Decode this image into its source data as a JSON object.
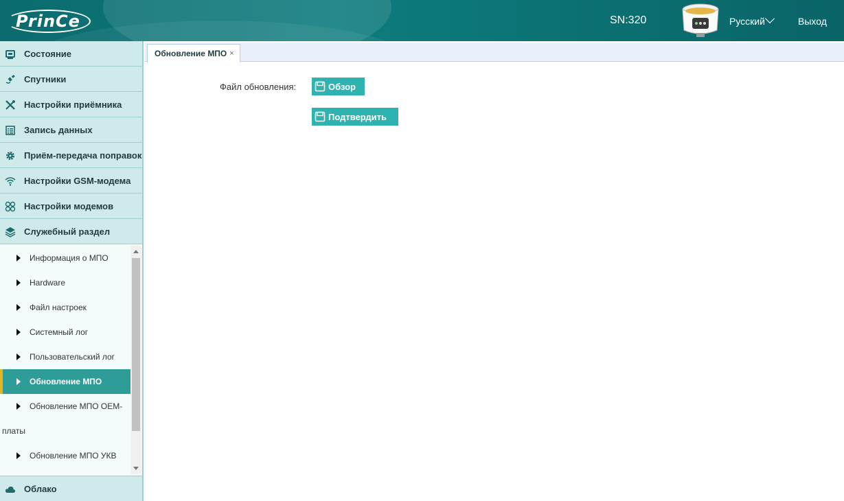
{
  "header": {
    "logo_text": "PrinCe",
    "serial": "SN:320",
    "language": "Русский",
    "logout": "Выход"
  },
  "sidebar": {
    "items": [
      {
        "label": "Состояние",
        "icon": "monitor-icon"
      },
      {
        "label": "Спутники",
        "icon": "satellite-icon"
      },
      {
        "label": "Настройки приёмника",
        "icon": "tools-icon"
      },
      {
        "label": "Запись данных",
        "icon": "list-icon"
      },
      {
        "label": "Приём-передача поправок",
        "icon": "gear-icon"
      },
      {
        "label": "Настройки GSM-модема",
        "icon": "wifi-icon"
      },
      {
        "label": "Настройки модемов",
        "icon": "modem-icon"
      },
      {
        "label": "Служебный раздел",
        "icon": "layers-icon"
      }
    ],
    "submenu": [
      {
        "label": "Информация о МПО"
      },
      {
        "label": "Hardware"
      },
      {
        "label": "Файл настроек"
      },
      {
        "label": "Системный лог"
      },
      {
        "label": "Пользовательский лог"
      },
      {
        "label": "Обновление МПО",
        "active": true
      },
      {
        "label": "Обновление МПО OEM-"
      },
      {
        "label": "платы"
      },
      {
        "label": "Обновление МПО УКВ"
      }
    ],
    "cloud": {
      "label": "Облако",
      "icon": "cloud-icon"
    }
  },
  "tabs": [
    {
      "label": "Обновление МПО",
      "close": "×"
    }
  ],
  "form": {
    "file_label": "Файл обновления:",
    "browse_label": "Обзор",
    "confirm_label": "Подтвердить"
  },
  "colors": {
    "header": "#0e7c7e",
    "menu_bg": "#cfeaea",
    "active_item": "#2e9d97",
    "active_marker": "#e6b41e",
    "button": "#2fb3b0"
  }
}
